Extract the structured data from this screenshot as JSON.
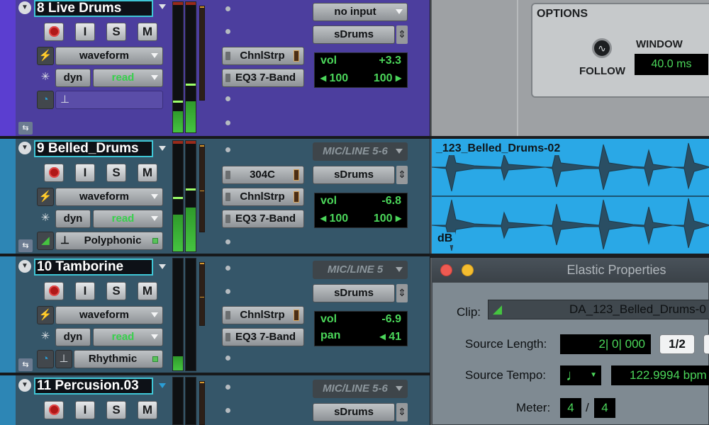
{
  "tracks": [
    {
      "number_name": "8  Live Drums",
      "buttons": {
        "input_monitor": "I",
        "solo": "S",
        "mute": "M"
      },
      "view": "waveform",
      "dyn": "dyn",
      "automation": "read",
      "elastic": "",
      "inserts": [
        "ChnlStrp",
        "EQ3 7-Band"
      ],
      "input": "no input",
      "output": "sDrums",
      "readout": {
        "r1_key": "vol",
        "r1_val": "+3.3",
        "r2_left": "◂ 100",
        "r2_right": "100 ▸"
      }
    },
    {
      "number_name": "9  Belled_Drums",
      "buttons": {
        "input_monitor": "I",
        "solo": "S",
        "mute": "M"
      },
      "view": "waveform",
      "dyn": "dyn",
      "automation": "read",
      "elastic": "Polyphonic",
      "inserts": [
        "304C",
        "ChnlStrp",
        "EQ3 7-Band"
      ],
      "input": "MIC/LINE 5-6",
      "output": "sDrums",
      "readout": {
        "r1_key": "vol",
        "r1_val": "-6.8",
        "r2_left": "◂ 100",
        "r2_right": "100 ▸"
      }
    },
    {
      "number_name": "10  Tamborine",
      "buttons": {
        "input_monitor": "I",
        "solo": "S",
        "mute": "M"
      },
      "view": "waveform",
      "dyn": "dyn",
      "automation": "read",
      "elastic": "Rhythmic",
      "inserts": [
        "ChnlStrp",
        "EQ3 7-Band"
      ],
      "input": "MIC/LINE 5",
      "output": "sDrums",
      "readout": {
        "r1_key": "vol",
        "r1_val": "-6.9",
        "r2_left": "pan",
        "r2_right": "◂ 41"
      }
    },
    {
      "number_name": "11 Percusion.03",
      "buttons": {
        "input_monitor": "I",
        "solo": "S",
        "mute": "M"
      },
      "input": "MIC/LINE 5-6",
      "output": "sDrums"
    }
  ],
  "options_panel": {
    "title": "OPTIONS",
    "follow_label": "FOLLOW",
    "window_label": "WINDOW",
    "window_value": "40.0 ms"
  },
  "clip": {
    "name": "_123_Belled_Drums-02",
    "unit": "dB"
  },
  "elastic_properties": {
    "title": "Elastic Properties",
    "clip_label": "Clip:",
    "clip_value": "DA_123_Belled_Drums-0",
    "source_length_label": "Source Length:",
    "source_length_value": "2| 0| 000",
    "half_button": "1/2",
    "source_tempo_label": "Source Tempo:",
    "source_tempo_value": "122.9994 bpm",
    "meter_label": "Meter:",
    "meter_num": "4",
    "meter_sep": "/",
    "meter_den": "4"
  },
  "colors": {
    "track8": "#4c3e9e",
    "track_blue": "#355669",
    "clip": "#2aa8e6",
    "readout_green": "#4bd65a"
  }
}
